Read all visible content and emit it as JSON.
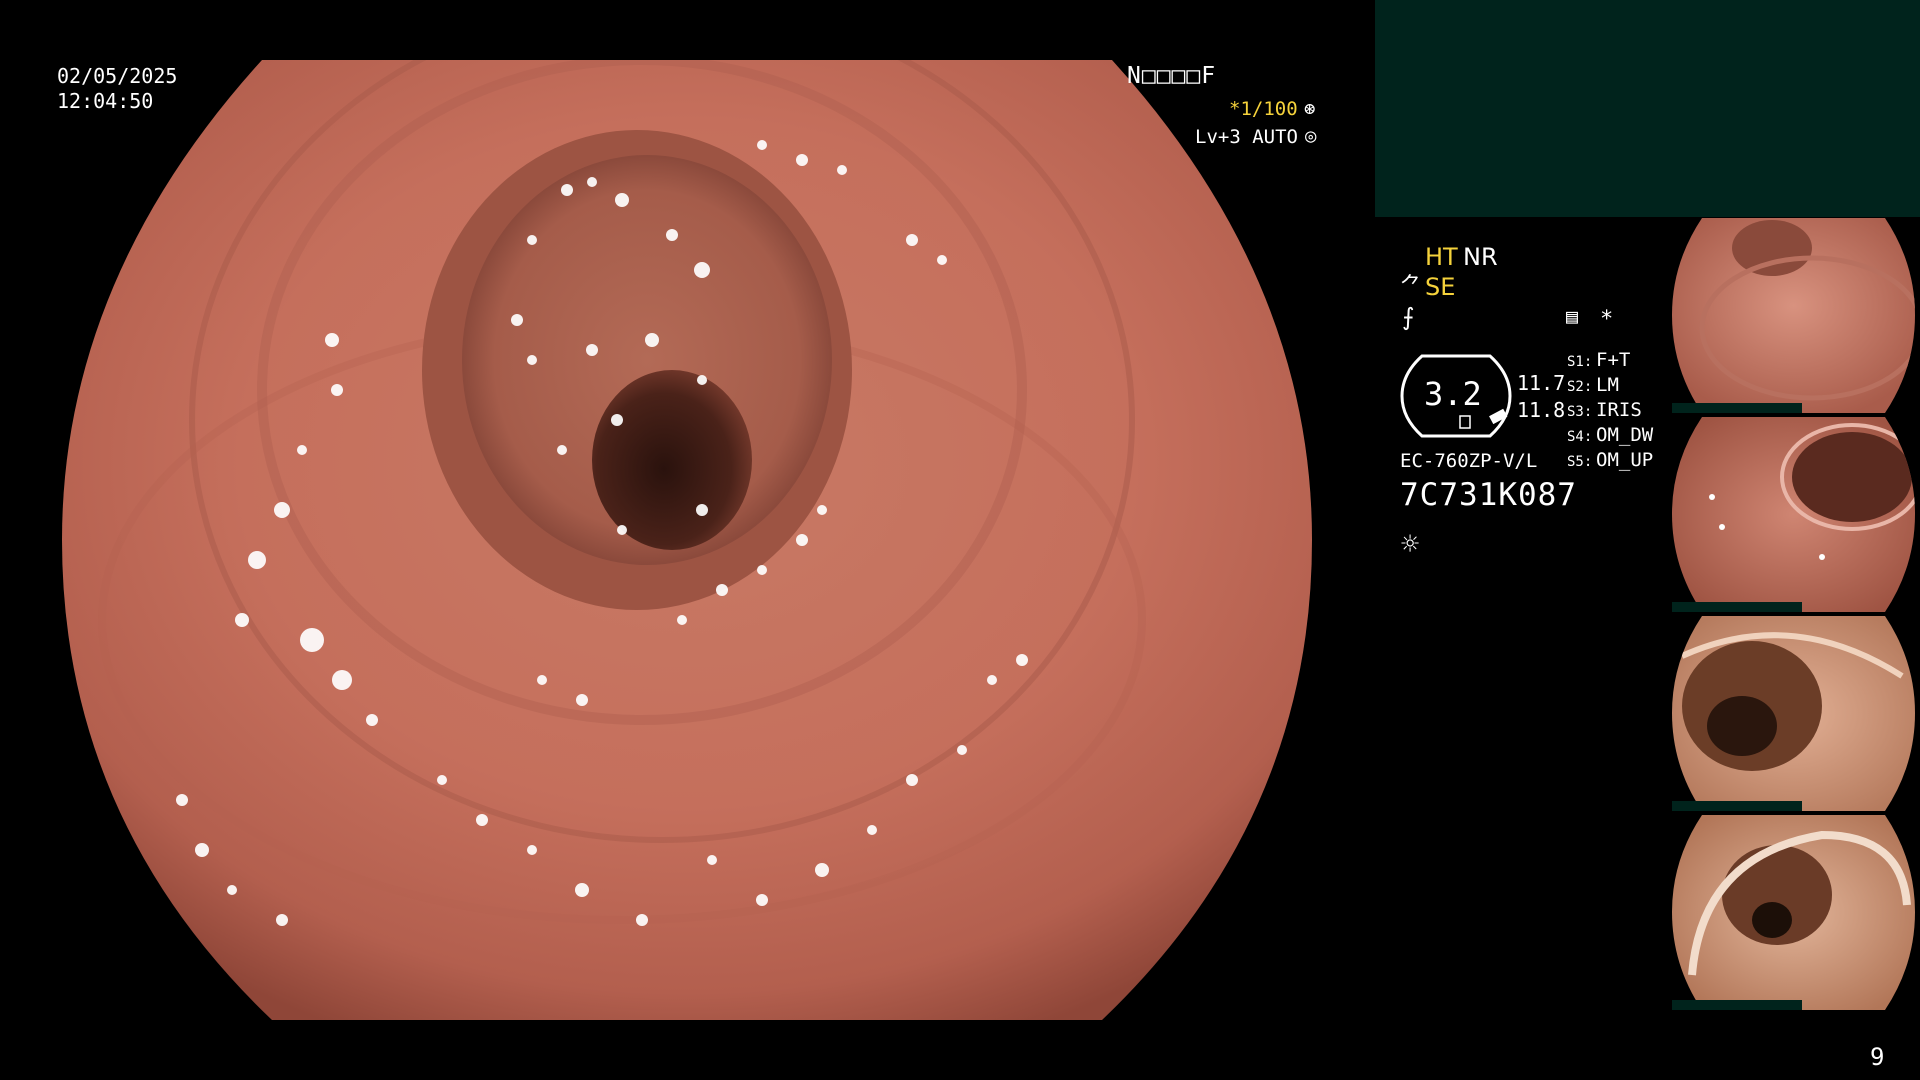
{
  "screen": {
    "osd": {
      "date": "02/05/2025",
      "time": "12:04:50",
      "mode": "N□□□□F",
      "shutter": "*1/100",
      "shutter_icon": "⊛",
      "level": "Lv+3 AUTO",
      "level_icon": "◎"
    },
    "panel": {
      "ht": "HT",
      "nr": "NR",
      "se_symbol": "⺈",
      "se": "SE",
      "f_symbol": "⨍",
      "doc_icon": "▤",
      "star": "*",
      "gauge": "3.2",
      "pressure_1": "11.7",
      "pressure_2": "11.8",
      "presets": [
        {
          "key": "S1:",
          "value": "F+T"
        },
        {
          "key": "S2:",
          "value": "LM"
        },
        {
          "key": "S3:",
          "value": "IRIS"
        },
        {
          "key": "S4:",
          "value": "OM_DW"
        },
        {
          "key": "S5:",
          "value": "OM_UP"
        }
      ],
      "scope_model": "EC-760ZP-V/L",
      "scope_serial": "7C731K087",
      "light_icon": "☼"
    },
    "thumbnails": [
      {
        "id": "thumb-1"
      },
      {
        "id": "thumb-2"
      },
      {
        "id": "thumb-3"
      },
      {
        "id": "thumb-4"
      }
    ],
    "page_number": "9",
    "colors": {
      "tissue": "#c8735f",
      "tissue_dark": "#8c4638",
      "highlight_yellow": "#f5d23b",
      "panel_green": "#00231c"
    }
  }
}
